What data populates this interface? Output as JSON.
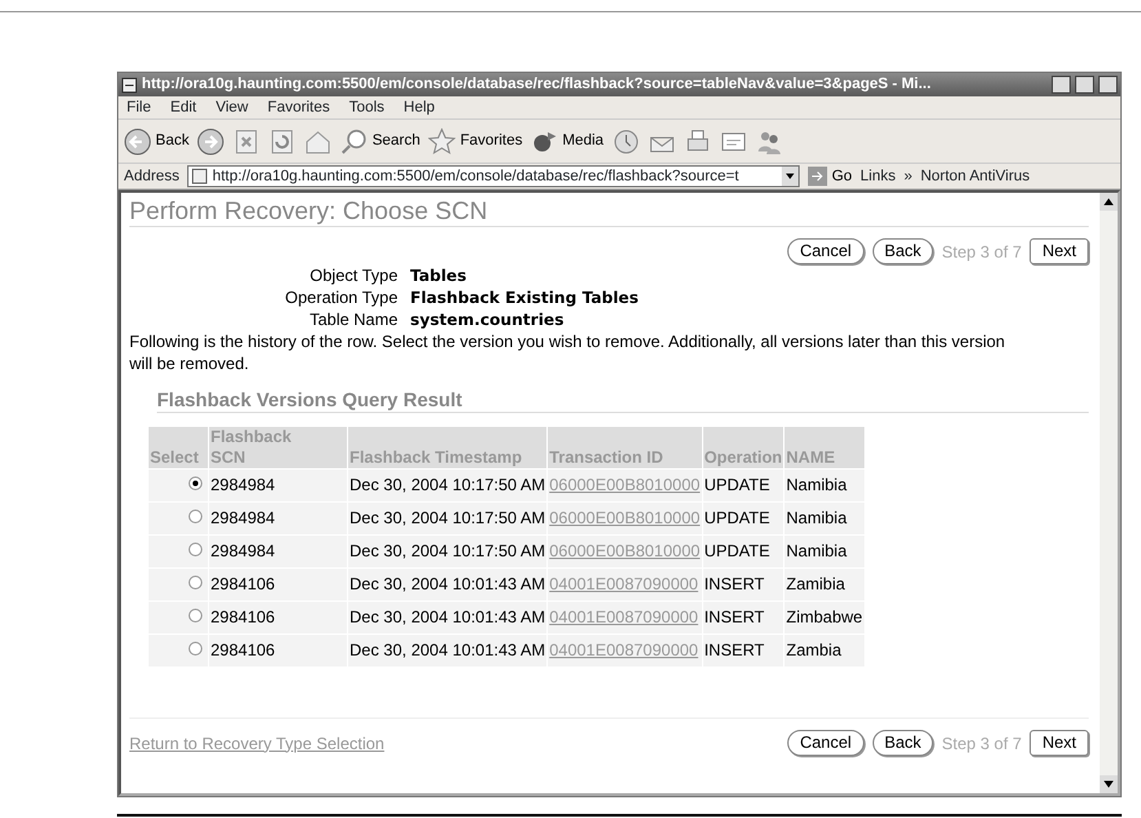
{
  "window": {
    "title": "http://ora10g.haunting.com:5500/em/console/database/rec/flashback?source=tableNav&value=3&pageS - Mi..."
  },
  "menu_bar": [
    "File",
    "Edit",
    "View",
    "Favorites",
    "Tools",
    "Help"
  ],
  "toolbar": [
    {
      "kind": "back",
      "label": "Back"
    },
    {
      "kind": "forward"
    },
    {
      "kind": "stop"
    },
    {
      "kind": "refresh"
    },
    {
      "kind": "home"
    },
    {
      "kind": "search",
      "label": "Search"
    },
    {
      "kind": "favorites",
      "label": "Favorites"
    },
    {
      "kind": "media",
      "label": "Media"
    },
    {
      "kind": "history"
    },
    {
      "kind": "mail"
    },
    {
      "kind": "print"
    },
    {
      "kind": "edit"
    },
    {
      "kind": "messenger"
    }
  ],
  "address_bar": {
    "label": "Address",
    "url": "http://ora10g.haunting.com:5500/em/console/database/rec/flashback?source=t",
    "go": "Go",
    "links": "Links",
    "links_more": "»",
    "norton": "Norton AntiVirus"
  },
  "page": {
    "title": "Perform Recovery: Choose SCN",
    "top_nav": {
      "cancel": "Cancel",
      "back": "Back",
      "step": "Step 3 of 7",
      "next": "Next"
    },
    "details": [
      {
        "label": "Object Type",
        "value": "Tables"
      },
      {
        "label": "Operation Type",
        "value": "Flashback Existing Tables"
      },
      {
        "label": "Table Name",
        "value": "system.countries"
      }
    ],
    "description": "Following is the history of the row. Select the version you wish to remove. Additionally, all versions later than this version will be removed.",
    "section_title": "Flashback Versions Query Result",
    "table": {
      "columns": [
        "Select",
        "Flashback SCN",
        "Flashback Timestamp",
        "Transaction ID",
        "Operation",
        "NAME"
      ],
      "rows": [
        {
          "selected": true,
          "scn": "2984984",
          "timestamp": "Dec 30, 2004 10:17:50 AM",
          "transaction_id": "06000E00B8010000",
          "operation": "UPDATE",
          "name": "Namibia"
        },
        {
          "selected": false,
          "scn": "2984984",
          "timestamp": "Dec 30, 2004 10:17:50 AM",
          "transaction_id": "06000E00B8010000",
          "operation": "UPDATE",
          "name": "Namibia"
        },
        {
          "selected": false,
          "scn": "2984984",
          "timestamp": "Dec 30, 2004 10:17:50 AM",
          "transaction_id": "06000E00B8010000",
          "operation": "UPDATE",
          "name": "Namibia"
        },
        {
          "selected": false,
          "scn": "2984106",
          "timestamp": "Dec 30, 2004 10:01:43 AM",
          "transaction_id": "04001E0087090000",
          "operation": "INSERT",
          "name": "Zamibia"
        },
        {
          "selected": false,
          "scn": "2984106",
          "timestamp": "Dec 30, 2004 10:01:43 AM",
          "transaction_id": "04001E0087090000",
          "operation": "INSERT",
          "name": "Zimbabwe"
        },
        {
          "selected": false,
          "scn": "2984106",
          "timestamp": "Dec 30, 2004 10:01:43 AM",
          "transaction_id": "04001E0087090000",
          "operation": "INSERT",
          "name": "Zambia"
        }
      ]
    },
    "bottom_nav": {
      "link": "Return to Recovery Type Selection",
      "cancel": "Cancel",
      "back": "Back",
      "step": "Step 3 of 7",
      "next": "Next"
    }
  }
}
